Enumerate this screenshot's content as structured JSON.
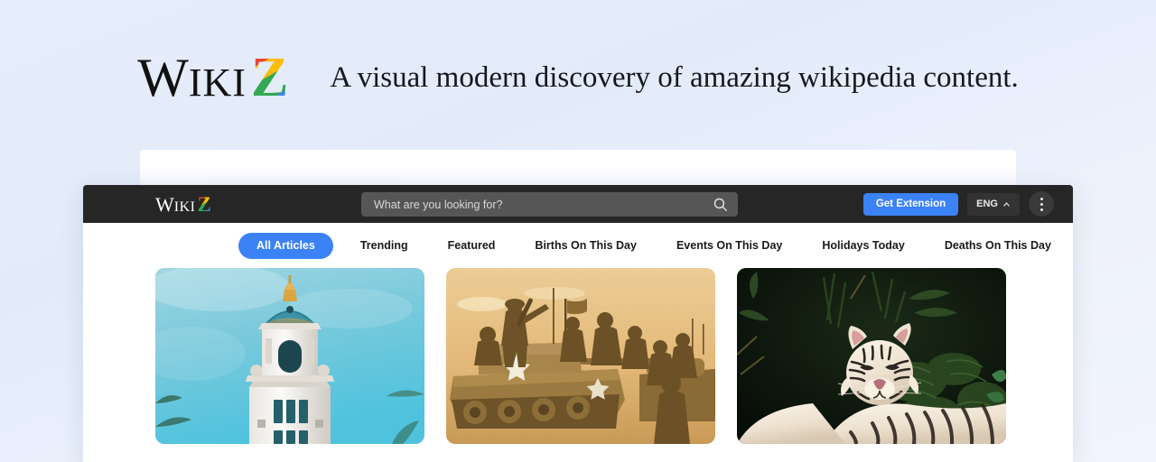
{
  "hero": {
    "logo": {
      "part1": "W",
      "part2": "IKI",
      "part3": "Z"
    },
    "tagline": "A visual modern discovery of amazing wikipedia content."
  },
  "topbar": {
    "logo": {
      "part1": "W",
      "part2": "IKI",
      "part3": "Z"
    },
    "search": {
      "placeholder": "What are you looking for?",
      "value": ""
    },
    "get_extension_label": "Get Extension",
    "language_label": "ENG"
  },
  "nav": {
    "tabs": [
      {
        "label": "All Articles",
        "active": true
      },
      {
        "label": "Trending",
        "active": false
      },
      {
        "label": "Featured",
        "active": false
      },
      {
        "label": "Births On This Day",
        "active": false
      },
      {
        "label": "Events On This Day",
        "active": false
      },
      {
        "label": "Holidays Today",
        "active": false
      },
      {
        "label": "Deaths On This Day",
        "active": false
      }
    ]
  },
  "cards": [
    {
      "name": "city-hall-tower"
    },
    {
      "name": "wwii-tanks"
    },
    {
      "name": "white-tiger"
    }
  ],
  "colors": {
    "accent": "#3b82f6",
    "topbar_bg": "#262626",
    "page_bg": "#e3ebfa",
    "logo_red": "#ea4335",
    "logo_yellow": "#fbbc05",
    "logo_green": "#34a853",
    "logo_blue": "#4285f4"
  }
}
